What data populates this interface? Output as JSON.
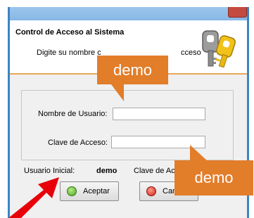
{
  "dialog": {
    "title": "Control de Acceso al Sistema",
    "subtitle_start": "Digite su nombre c",
    "subtitle_end": "cceso"
  },
  "form": {
    "user_label": "Nombre de Usuario:",
    "user_value": "",
    "password_label": "Clave de Acceso:",
    "password_value": ""
  },
  "footer": {
    "initial_user_label": "Usuario Inicial:",
    "initial_user_value": "demo",
    "initial_password_label": "Clave de Ac"
  },
  "buttons": {
    "accept_label": "Aceptar",
    "cancel_label": "Can"
  },
  "annotations": {
    "callout_user": "demo",
    "callout_password": "demo",
    "accent_color": "#e27d2a",
    "arrow_color": "#e8000b"
  },
  "icons": {
    "header": "keys-icon",
    "accept": "check-circle-icon",
    "cancel": "cancel-circle-icon"
  }
}
